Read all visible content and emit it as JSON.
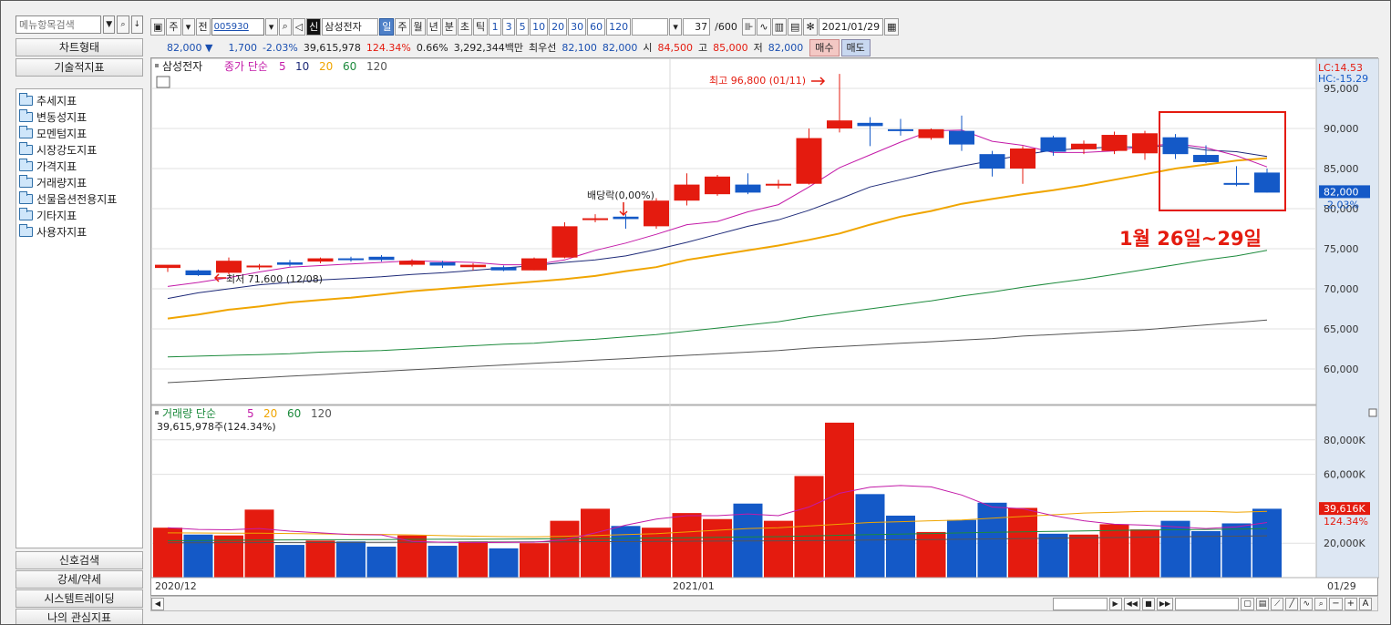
{
  "sidebar": {
    "search_placeholder": "메뉴항목검색",
    "header_chart_type": "차트형태",
    "header_indicators": "기술적지표",
    "items": [
      "추세지표",
      "변동성지표",
      "모멘텀지표",
      "시장강도지표",
      "가격지표",
      "거래량지표",
      "선물옵션전용지표",
      "기타지표",
      "사용자지표"
    ],
    "bottom": [
      "신호검색",
      "강세/약세",
      "시스템트레이딩",
      "나의 관심지표"
    ]
  },
  "toolbar": {
    "btn_week": "주",
    "btn_prev": "전",
    "ticker": "005930",
    "badge": "신",
    "stock_name": "삼성전자",
    "periods": [
      "일",
      "주",
      "월",
      "년",
      "분",
      "초",
      "틱"
    ],
    "minutes": [
      "1",
      "3",
      "5",
      "10",
      "20",
      "30",
      "60",
      "120"
    ],
    "count": "37",
    "count_total": "/600",
    "date": "2021/01/29"
  },
  "infobar": {
    "price": "82,000 ▼",
    "change": "1,700",
    "change_pct": "-2.03%",
    "volume": "39,615,978",
    "vol_ratio": "124.34%",
    "turnover": "0.66%",
    "amount": "3,292,344백만",
    "best_label": "최우선",
    "best_bid": "82,100",
    "best_ask": "82,000",
    "open_label": "시",
    "open": "84,500",
    "high_label": "고",
    "high": "85,000",
    "low_label": "저",
    "low": "82,000",
    "buy": "매수",
    "sell": "매도"
  },
  "colors": {
    "up": "#e41b0f",
    "down": "#1459c7",
    "ma5": "#c31aa8",
    "ma10": "#1e2a78",
    "ma20": "#f0a500",
    "ma60": "#1c8a3c",
    "ma120": "#555555"
  },
  "chart_data": {
    "type": "candlestick",
    "price_legend": {
      "name": "삼성전자",
      "label": "종가 단순",
      "periods": [
        "5",
        "10",
        "20",
        "60",
        "120"
      ]
    },
    "volume_legend": {
      "label": "거래량 단순",
      "periods": [
        "5",
        "20",
        "60",
        "120"
      ],
      "summary": "39,615,978주(124.34%)"
    },
    "price_axis": {
      "ticks": [
        95000,
        90000,
        85000,
        80000,
        75000,
        70000,
        65000,
        60000
      ],
      "tick_labels": [
        "95,000",
        "90,000",
        "85,000",
        "80,000",
        "75,000",
        "70,000",
        "65,000",
        "60,000"
      ],
      "current_label": "82,000",
      "current_pct": "-2.03%",
      "lc": "LC:14.53",
      "hc": "HC:-15.29"
    },
    "volume_axis": {
      "ticks": [
        80000,
        60000,
        20000
      ],
      "tick_labels": [
        "80,000K",
        "60,000K",
        "20,000K"
      ],
      "current_label": "39,616K",
      "current_pct": "124.34%"
    },
    "x_labels": [
      "2020/12",
      "2021/01",
      "01/29"
    ],
    "candles": [
      {
        "o": 72600,
        "h": 72900,
        "l": 72100,
        "c": 73000,
        "v": 29000
      },
      {
        "o": 72300,
        "h": 72400,
        "l": 71600,
        "c": 71700,
        "v": 25000
      },
      {
        "o": 72000,
        "h": 73900,
        "l": 71800,
        "c": 73500,
        "v": 24500
      },
      {
        "o": 72800,
        "h": 73100,
        "l": 72400,
        "c": 72900,
        "v": 39500
      },
      {
        "o": 73300,
        "h": 73600,
        "l": 72800,
        "c": 73000,
        "v": 19000
      },
      {
        "o": 73400,
        "h": 73900,
        "l": 73200,
        "c": 73800,
        "v": 21500
      },
      {
        "o": 73800,
        "h": 74000,
        "l": 73400,
        "c": 73600,
        "v": 21000
      },
      {
        "o": 74000,
        "h": 74200,
        "l": 73400,
        "c": 73600,
        "v": 18000
      },
      {
        "o": 73000,
        "h": 73700,
        "l": 72800,
        "c": 73500,
        "v": 24500
      },
      {
        "o": 73300,
        "h": 73500,
        "l": 72600,
        "c": 72900,
        "v": 18500
      },
      {
        "o": 72700,
        "h": 73200,
        "l": 72300,
        "c": 73000,
        "v": 21000
      },
      {
        "o": 72700,
        "h": 72900,
        "l": 72200,
        "c": 72300,
        "v": 17000
      },
      {
        "o": 72300,
        "h": 73900,
        "l": 72300,
        "c": 73800,
        "v": 20000
      },
      {
        "o": 73900,
        "h": 78300,
        "l": 73800,
        "c": 77800,
        "v": 33000
      },
      {
        "o": 78800,
        "h": 79300,
        "l": 78300,
        "c": 78800,
        "v": 40000
      },
      {
        "o": 79000,
        "h": 79300,
        "l": 77500,
        "c": 78700,
        "v": 30000
      },
      {
        "o": 77800,
        "h": 81300,
        "l": 77500,
        "c": 81000,
        "v": 29000
      },
      {
        "o": 81000,
        "h": 84400,
        "l": 80400,
        "c": 83000,
        "v": 37500
      },
      {
        "o": 81800,
        "h": 84200,
        "l": 81600,
        "c": 84000,
        "v": 34000
      },
      {
        "o": 83000,
        "h": 84400,
        "l": 81800,
        "c": 82000,
        "v": 43000
      },
      {
        "o": 82900,
        "h": 83600,
        "l": 82500,
        "c": 83100,
        "v": 33000
      },
      {
        "o": 83100,
        "h": 90000,
        "l": 83000,
        "c": 88800,
        "v": 59000
      },
      {
        "o": 90000,
        "h": 96800,
        "l": 89500,
        "c": 91000,
        "v": 90000
      },
      {
        "o": 90700,
        "h": 91400,
        "l": 87800,
        "c": 90300,
        "v": 48500
      },
      {
        "o": 89900,
        "h": 91200,
        "l": 89100,
        "c": 89700,
        "v": 36000
      },
      {
        "o": 88800,
        "h": 90000,
        "l": 88600,
        "c": 89900,
        "v": 26500
      },
      {
        "o": 89700,
        "h": 91600,
        "l": 87200,
        "c": 88000,
        "v": 33500
      },
      {
        "o": 86800,
        "h": 87200,
        "l": 84000,
        "c": 85000,
        "v": 43500
      },
      {
        "o": 85000,
        "h": 87800,
        "l": 83100,
        "c": 87500,
        "v": 40500
      },
      {
        "o": 88900,
        "h": 89100,
        "l": 86600,
        "c": 87100,
        "v": 25500
      },
      {
        "o": 87400,
        "h": 88500,
        "l": 86800,
        "c": 88100,
        "v": 25000
      },
      {
        "o": 87200,
        "h": 89600,
        "l": 86800,
        "c": 89200,
        "v": 31000
      },
      {
        "o": 86900,
        "h": 89700,
        "l": 86100,
        "c": 89400,
        "v": 28000
      },
      {
        "o": 88900,
        "h": 89300,
        "l": 86200,
        "c": 86800,
        "v": 33000
      },
      {
        "o": 86700,
        "h": 87900,
        "l": 85700,
        "c": 85800,
        "v": 27000
      },
      {
        "o": 83200,
        "h": 85300,
        "l": 82800,
        "c": 83000,
        "v": 31500
      },
      {
        "o": 84500,
        "h": 85000,
        "l": 82000,
        "c": 82000,
        "v": 40000
      }
    ],
    "ma5": [
      70300,
      70800,
      71400,
      72100,
      72700,
      72900,
      73100,
      73300,
      73500,
      73400,
      73300,
      73000,
      73000,
      73600,
      74800,
      75700,
      76800,
      78000,
      78400,
      79600,
      80500,
      82700,
      85100,
      86700,
      88300,
      89700,
      89800,
      88400,
      87900,
      87000,
      87000,
      87200,
      87800,
      88100,
      87600,
      86600,
      85200
    ],
    "ma10": [
      68800,
      69500,
      70000,
      70500,
      70800,
      71100,
      71300,
      71500,
      71800,
      72000,
      72300,
      72600,
      72900,
      73300,
      73600,
      74100,
      74900,
      75800,
      76800,
      77800,
      78600,
      79800,
      81200,
      82700,
      83600,
      84500,
      85300,
      86000,
      86700,
      87300,
      87500,
      87700,
      87700,
      87900,
      87300,
      87100,
      86500
    ],
    "ma20": [
      66300,
      66800,
      67400,
      67800,
      68300,
      68600,
      68900,
      69300,
      69700,
      70000,
      70300,
      70600,
      70900,
      71200,
      71600,
      72200,
      72700,
      73600,
      74200,
      74800,
      75400,
      76100,
      76900,
      78000,
      79000,
      79700,
      80600,
      81200,
      81800,
      82300,
      82900,
      83600,
      84300,
      85000,
      85500,
      86000,
      86300
    ],
    "ma60": [
      61500,
      61600,
      61700,
      61800,
      61900,
      62100,
      62200,
      62300,
      62500,
      62700,
      62900,
      63100,
      63200,
      63500,
      63700,
      64000,
      64300,
      64700,
      65100,
      65500,
      65900,
      66500,
      67000,
      67500,
      68000,
      68500,
      69100,
      69600,
      70200,
      70700,
      71200,
      71800,
      72400,
      73000,
      73600,
      74100,
      74800
    ],
    "ma120": [
      58300,
      58500,
      58700,
      58900,
      59100,
      59300,
      59500,
      59700,
      59900,
      60100,
      60300,
      60500,
      60700,
      60900,
      61100,
      61300,
      61500,
      61700,
      61900,
      62100,
      62300,
      62600,
      62800,
      63000,
      63200,
      63400,
      63600,
      63800,
      64100,
      64300,
      64500,
      64700,
      64900,
      65200,
      65500,
      65800,
      66100
    ],
    "vol_ma5": [
      29000,
      28000,
      27800,
      28500,
      27000,
      26000,
      25000,
      24800,
      21000,
      20600,
      20300,
      20400,
      20600,
      22000,
      26000,
      30500,
      34000,
      36000,
      36000,
      37000,
      36000,
      41000,
      49000,
      52500,
      53500,
      52700,
      48000,
      41000,
      40000,
      36000,
      33000,
      31000,
      30500,
      29500,
      28500,
      29500,
      32000
    ],
    "vol_ma20": [
      26000,
      25900,
      25800,
      25800,
      25600,
      25400,
      25200,
      25100,
      24800,
      24400,
      24100,
      23800,
      23700,
      24000,
      24500,
      25000,
      25500,
      26500,
      27500,
      28500,
      29000,
      30000,
      31000,
      32000,
      32500,
      33000,
      33500,
      34500,
      35500,
      36500,
      37500,
      38000,
      38500,
      38500,
      38500,
      38000,
      38500
    ],
    "vol_ma60": [
      21500,
      21600,
      21700,
      21800,
      21900,
      22000,
      22000,
      22100,
      22200,
      22300,
      22300,
      22400,
      22500,
      22600,
      22700,
      22800,
      23000,
      23200,
      23400,
      23600,
      23800,
      24200,
      24600,
      25000,
      25300,
      25600,
      26000,
      26300,
      26600,
      26900,
      27100,
      27400,
      27600,
      27800,
      28000,
      28200,
      28500
    ],
    "vol_ma120": [
      20200,
      20200,
      20300,
      20300,
      20400,
      20400,
      20500,
      20500,
      20600,
      20600,
      20700,
      20700,
      20800,
      20800,
      20900,
      20900,
      21000,
      21100,
      21200,
      21300,
      21400,
      21500,
      21600,
      21800,
      22000,
      22100,
      22300,
      22500,
      22700,
      22900,
      23100,
      23300,
      23500,
      23700,
      23900,
      24100,
      24300
    ],
    "annotations": {
      "high": "최고 96,800 (01/11)",
      "low": "최저 71,600 (12/08)",
      "dividend": "배당락(0,00%)",
      "highlight": "1월 26일~29일"
    }
  }
}
